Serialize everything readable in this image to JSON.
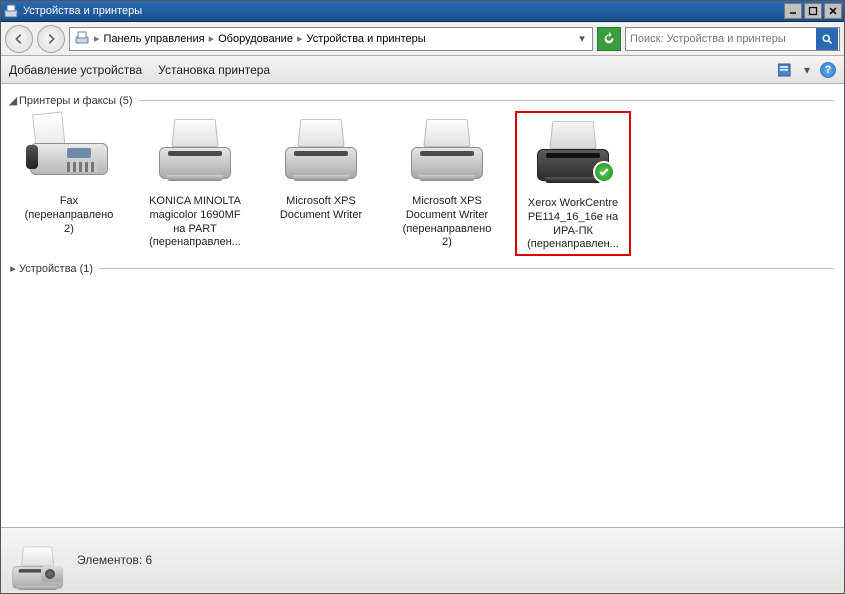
{
  "window": {
    "title": "Устройства и принтеры"
  },
  "breadcrumb": {
    "seg1": "Панель управления",
    "seg2": "Оборудование",
    "seg3": "Устройства и принтеры"
  },
  "search": {
    "placeholder": "Поиск: Устройства и принтеры"
  },
  "toolbar": {
    "add_device": "Добавление устройства",
    "add_printer": "Установка принтера"
  },
  "groups": {
    "printers": {
      "label": "Принтеры и факсы",
      "count": "(5)"
    },
    "devices": {
      "label": "Устройства",
      "count": "(1)"
    }
  },
  "items": {
    "fax": {
      "l1": "Fax",
      "l2": "(перенаправлено",
      "l3": "2)"
    },
    "km": {
      "l1": "KONICA MINOLTA",
      "l2": "magicolor 1690MF",
      "l3": "на PART",
      "l4": "(перенаправлен..."
    },
    "xps1": {
      "l1": "Microsoft XPS",
      "l2": "Document Writer"
    },
    "xps2": {
      "l1": "Microsoft XPS",
      "l2": "Document Writer",
      "l3": "(перенаправлено",
      "l4": "2)"
    },
    "xerox": {
      "l1": "Xerox WorkCentre",
      "l2": "PE114_16_16e на",
      "l3": "ИРА-ПК",
      "l4": "(перенаправлен..."
    }
  },
  "status": {
    "count_label": "Элементов:",
    "count": "6"
  }
}
